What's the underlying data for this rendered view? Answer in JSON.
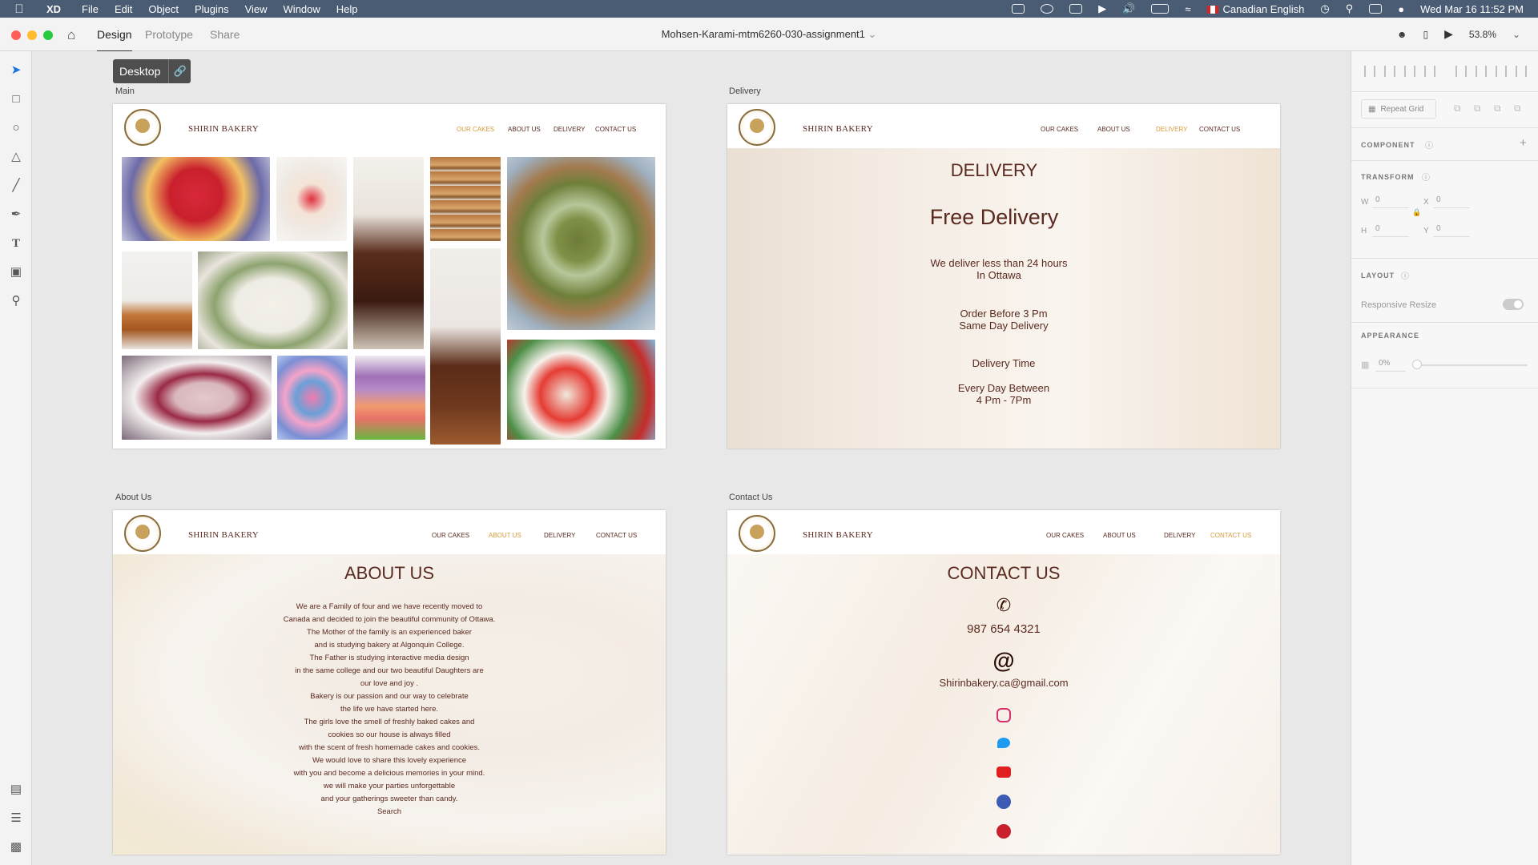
{
  "menubar": {
    "app_name": "XD",
    "items": [
      "File",
      "Edit",
      "Object",
      "Plugins",
      "View",
      "Window",
      "Help"
    ],
    "language": "Canadian English",
    "clock": "Wed Mar 16  11:52 PM"
  },
  "titlebar": {
    "tabs": [
      "Design",
      "Prototype",
      "Share"
    ],
    "active_tab": "Design",
    "document_title": "Mohsen-Karami-mtm6260-030-assignment1",
    "zoom": "53.8%"
  },
  "canvas": {
    "device_chip": "Desktop",
    "artboards": {
      "main": {
        "label": "Main"
      },
      "delivery": {
        "label": "Delivery"
      },
      "about": {
        "label": "About Us"
      },
      "contact": {
        "label": "Contact Us"
      }
    }
  },
  "site": {
    "brand": "SHIRIN BAKERY",
    "nav": [
      "OUR CAKES",
      "ABOUT US",
      "DELIVERY",
      "CONTACT US"
    ]
  },
  "delivery": {
    "heading": "DELIVERY",
    "subheading": "Free Delivery",
    "line1": "We deliver less than 24 hours",
    "line2": "In Ottawa",
    "line3": "Order Before 3 Pm",
    "line4": "Same Day Delivery",
    "line5": "Delivery Time",
    "line6": "Every Day Between",
    "line7": "4 Pm - 7Pm"
  },
  "about": {
    "heading": "ABOUT US",
    "lines": [
      "We are a Family of four and we have recently moved to",
      "Canada and decided to join the beautiful community of Ottawa.",
      "The Mother of the family is an experienced baker",
      "and is studying bakery at Algonquin College.",
      "The Father is studying interactive media design",
      "in the same college and our two beautiful Daughters are",
      "our love and joy .",
      "Bakery is our passion and our way to celebrate",
      "the life we have started here.",
      "The girls love the smell of freshly baked cakes and",
      "cookies so our house is always filled",
      "with the scent of fresh homemade cakes and cookies.",
      "We would love to share this lovely experience",
      "with you and become a delicious memories in your mind.",
      "we will make your parties unforgettable",
      "and your gatherings sweeter than candy.",
      "Search"
    ]
  },
  "contact": {
    "heading": "CONTACT US",
    "phone": "987 654 4321",
    "at_symbol": "@",
    "email": "Shirinbakery.ca@gmail.com",
    "social_icons": [
      "instagram-icon",
      "twitter-icon",
      "youtube-icon",
      "facebook-icon",
      "pinterest-icon"
    ]
  },
  "panel": {
    "repeat_grid": "Repeat Grid",
    "component": "COMPONENT",
    "transform": "TRANSFORM",
    "w_label": "W",
    "w_value": "0",
    "x_label": "X",
    "x_value": "0",
    "h_label": "H",
    "h_value": "0",
    "y_label": "Y",
    "y_value": "0",
    "layout": "LAYOUT",
    "responsive_resize": "Responsive Resize",
    "appearance": "APPEARANCE",
    "opacity": "0%"
  },
  "colors": {
    "brand_brown": "#5a2a20",
    "accent_gold": "#d89a3a",
    "menubar": "#4a5c74"
  }
}
